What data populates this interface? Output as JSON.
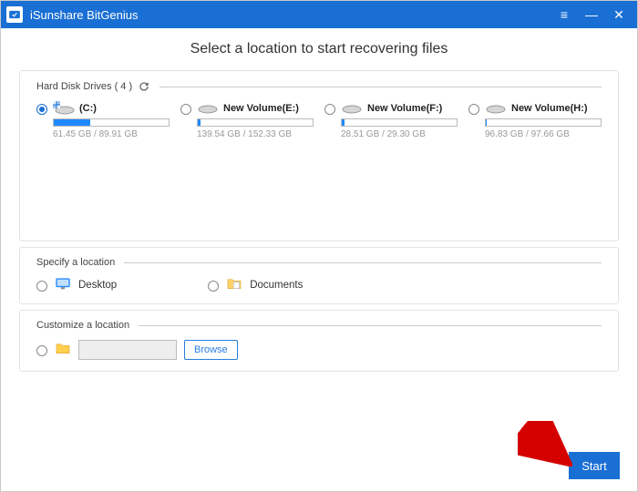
{
  "app_name": "iSunshare BitGenius",
  "main_title": "Select a location to start recovering files",
  "sections": {
    "drives_header": "Hard Disk Drives ( 4 )",
    "specify_header": "Specify a location",
    "customize_header": "Customize a location"
  },
  "drives": [
    {
      "name": "(C:)",
      "size": "61.45 GB / 89.91 GB",
      "fill_pct": 32,
      "selected": true,
      "os_badge": true
    },
    {
      "name": "New Volume(E:)",
      "size": "139.54 GB / 152.33 GB",
      "fill_pct": 2,
      "selected": false,
      "os_badge": false
    },
    {
      "name": "New Volume(F:)",
      "size": "28.51 GB / 29.30 GB",
      "fill_pct": 2,
      "selected": false,
      "os_badge": false
    },
    {
      "name": "New Volume(H:)",
      "size": "96.83 GB / 97.66 GB",
      "fill_pct": 1,
      "selected": false,
      "os_badge": false
    }
  ],
  "specify": {
    "desktop_label": "Desktop",
    "documents_label": "Documents"
  },
  "customize": {
    "browse_label": "Browse",
    "path_value": ""
  },
  "start_label": "Start",
  "colors": {
    "accent": "#1a6fd4"
  }
}
